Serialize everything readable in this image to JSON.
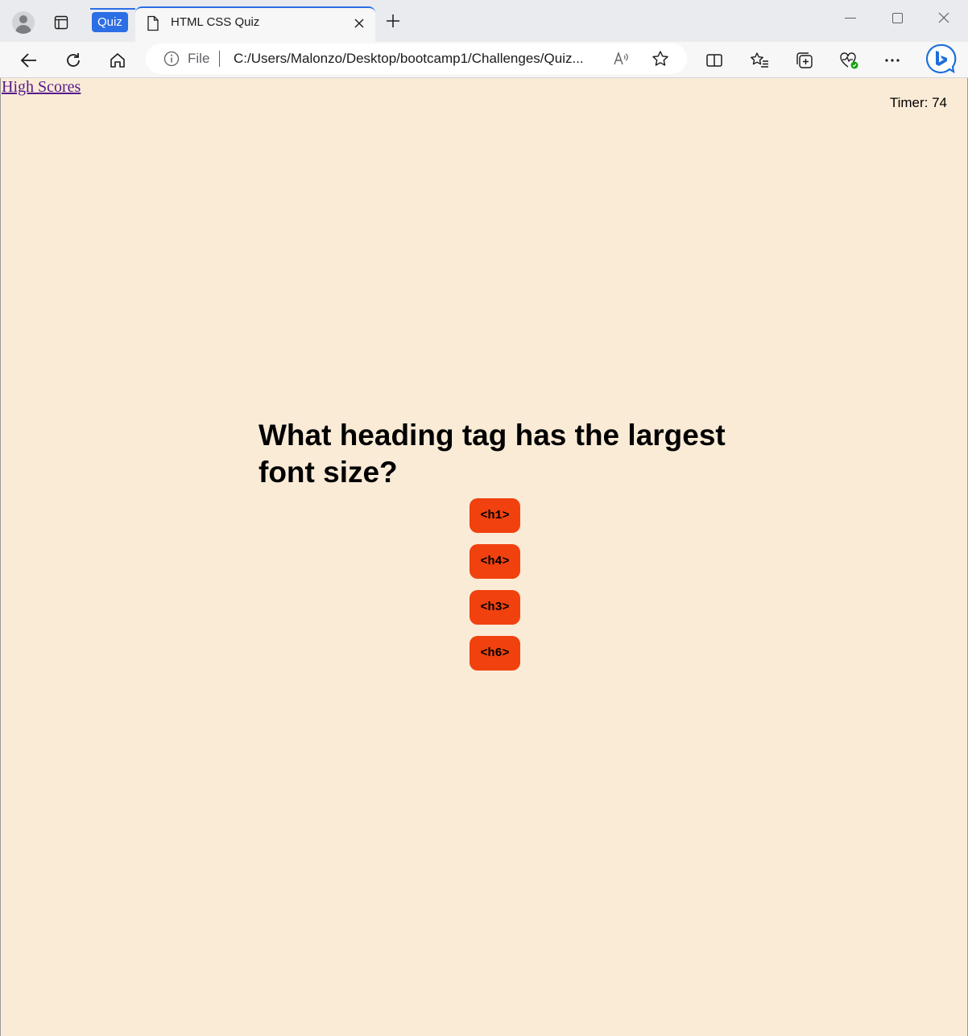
{
  "browser": {
    "tab_group_label": "Quiz",
    "tab_title": "HTML CSS Quiz",
    "address": {
      "scheme_label": "File",
      "url": "C:/Users/Malonzo/Desktop/bootcamp1/Challenges/Quiz..."
    },
    "icons": {
      "profile": "profile-avatar-icon",
      "workspaces": "tab-actions-icon",
      "page": "page-icon",
      "close_tab": "close-icon",
      "new_tab": "plus-icon",
      "back": "back-arrow-icon",
      "refresh": "refresh-icon",
      "home": "home-icon",
      "site_info": "info-icon",
      "read_aloud": "read-aloud-icon",
      "favorite": "star-icon",
      "split_screen": "split-screen-icon",
      "favorites": "favorites-icon",
      "collections": "collections-icon",
      "performance": "heartbeat-icon",
      "more": "more-icon",
      "copilot": "bing-icon"
    },
    "accent_color": "#2b6ee6"
  },
  "page": {
    "high_scores_link": "High Scores",
    "timer_label": "Timer: 74",
    "question": "What heading tag has the largest font size?",
    "answers": [
      "<h1>",
      "<h4>",
      "<h3>",
      "<h6>"
    ],
    "background_color": "#faebd7",
    "button_color": "#f1410e"
  }
}
